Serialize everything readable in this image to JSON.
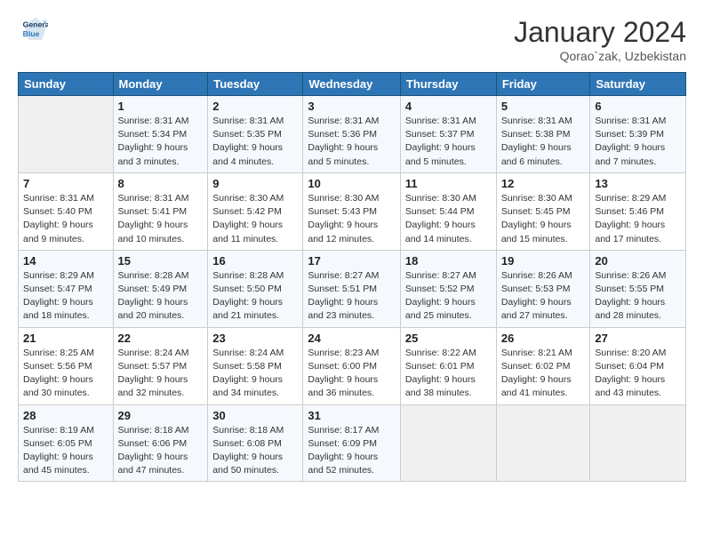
{
  "header": {
    "logo_line1": "General",
    "logo_line2": "Blue",
    "title": "January 2024",
    "location": "Qorao`zak, Uzbekistan"
  },
  "weekdays": [
    "Sunday",
    "Monday",
    "Tuesday",
    "Wednesday",
    "Thursday",
    "Friday",
    "Saturday"
  ],
  "weeks": [
    [
      {
        "day": "",
        "detail": ""
      },
      {
        "day": "1",
        "detail": "Sunrise: 8:31 AM\nSunset: 5:34 PM\nDaylight: 9 hours\nand 3 minutes."
      },
      {
        "day": "2",
        "detail": "Sunrise: 8:31 AM\nSunset: 5:35 PM\nDaylight: 9 hours\nand 4 minutes."
      },
      {
        "day": "3",
        "detail": "Sunrise: 8:31 AM\nSunset: 5:36 PM\nDaylight: 9 hours\nand 5 minutes."
      },
      {
        "day": "4",
        "detail": "Sunrise: 8:31 AM\nSunset: 5:37 PM\nDaylight: 9 hours\nand 5 minutes."
      },
      {
        "day": "5",
        "detail": "Sunrise: 8:31 AM\nSunset: 5:38 PM\nDaylight: 9 hours\nand 6 minutes."
      },
      {
        "day": "6",
        "detail": "Sunrise: 8:31 AM\nSunset: 5:39 PM\nDaylight: 9 hours\nand 7 minutes."
      }
    ],
    [
      {
        "day": "7",
        "detail": "Sunrise: 8:31 AM\nSunset: 5:40 PM\nDaylight: 9 hours\nand 9 minutes."
      },
      {
        "day": "8",
        "detail": "Sunrise: 8:31 AM\nSunset: 5:41 PM\nDaylight: 9 hours\nand 10 minutes."
      },
      {
        "day": "9",
        "detail": "Sunrise: 8:30 AM\nSunset: 5:42 PM\nDaylight: 9 hours\nand 11 minutes."
      },
      {
        "day": "10",
        "detail": "Sunrise: 8:30 AM\nSunset: 5:43 PM\nDaylight: 9 hours\nand 12 minutes."
      },
      {
        "day": "11",
        "detail": "Sunrise: 8:30 AM\nSunset: 5:44 PM\nDaylight: 9 hours\nand 14 minutes."
      },
      {
        "day": "12",
        "detail": "Sunrise: 8:30 AM\nSunset: 5:45 PM\nDaylight: 9 hours\nand 15 minutes."
      },
      {
        "day": "13",
        "detail": "Sunrise: 8:29 AM\nSunset: 5:46 PM\nDaylight: 9 hours\nand 17 minutes."
      }
    ],
    [
      {
        "day": "14",
        "detail": "Sunrise: 8:29 AM\nSunset: 5:47 PM\nDaylight: 9 hours\nand 18 minutes."
      },
      {
        "day": "15",
        "detail": "Sunrise: 8:28 AM\nSunset: 5:49 PM\nDaylight: 9 hours\nand 20 minutes."
      },
      {
        "day": "16",
        "detail": "Sunrise: 8:28 AM\nSunset: 5:50 PM\nDaylight: 9 hours\nand 21 minutes."
      },
      {
        "day": "17",
        "detail": "Sunrise: 8:27 AM\nSunset: 5:51 PM\nDaylight: 9 hours\nand 23 minutes."
      },
      {
        "day": "18",
        "detail": "Sunrise: 8:27 AM\nSunset: 5:52 PM\nDaylight: 9 hours\nand 25 minutes."
      },
      {
        "day": "19",
        "detail": "Sunrise: 8:26 AM\nSunset: 5:53 PM\nDaylight: 9 hours\nand 27 minutes."
      },
      {
        "day": "20",
        "detail": "Sunrise: 8:26 AM\nSunset: 5:55 PM\nDaylight: 9 hours\nand 28 minutes."
      }
    ],
    [
      {
        "day": "21",
        "detail": "Sunrise: 8:25 AM\nSunset: 5:56 PM\nDaylight: 9 hours\nand 30 minutes."
      },
      {
        "day": "22",
        "detail": "Sunrise: 8:24 AM\nSunset: 5:57 PM\nDaylight: 9 hours\nand 32 minutes."
      },
      {
        "day": "23",
        "detail": "Sunrise: 8:24 AM\nSunset: 5:58 PM\nDaylight: 9 hours\nand 34 minutes."
      },
      {
        "day": "24",
        "detail": "Sunrise: 8:23 AM\nSunset: 6:00 PM\nDaylight: 9 hours\nand 36 minutes."
      },
      {
        "day": "25",
        "detail": "Sunrise: 8:22 AM\nSunset: 6:01 PM\nDaylight: 9 hours\nand 38 minutes."
      },
      {
        "day": "26",
        "detail": "Sunrise: 8:21 AM\nSunset: 6:02 PM\nDaylight: 9 hours\nand 41 minutes."
      },
      {
        "day": "27",
        "detail": "Sunrise: 8:20 AM\nSunset: 6:04 PM\nDaylight: 9 hours\nand 43 minutes."
      }
    ],
    [
      {
        "day": "28",
        "detail": "Sunrise: 8:19 AM\nSunset: 6:05 PM\nDaylight: 9 hours\nand 45 minutes."
      },
      {
        "day": "29",
        "detail": "Sunrise: 8:18 AM\nSunset: 6:06 PM\nDaylight: 9 hours\nand 47 minutes."
      },
      {
        "day": "30",
        "detail": "Sunrise: 8:18 AM\nSunset: 6:08 PM\nDaylight: 9 hours\nand 50 minutes."
      },
      {
        "day": "31",
        "detail": "Sunrise: 8:17 AM\nSunset: 6:09 PM\nDaylight: 9 hours\nand 52 minutes."
      },
      {
        "day": "",
        "detail": ""
      },
      {
        "day": "",
        "detail": ""
      },
      {
        "day": "",
        "detail": ""
      }
    ]
  ]
}
